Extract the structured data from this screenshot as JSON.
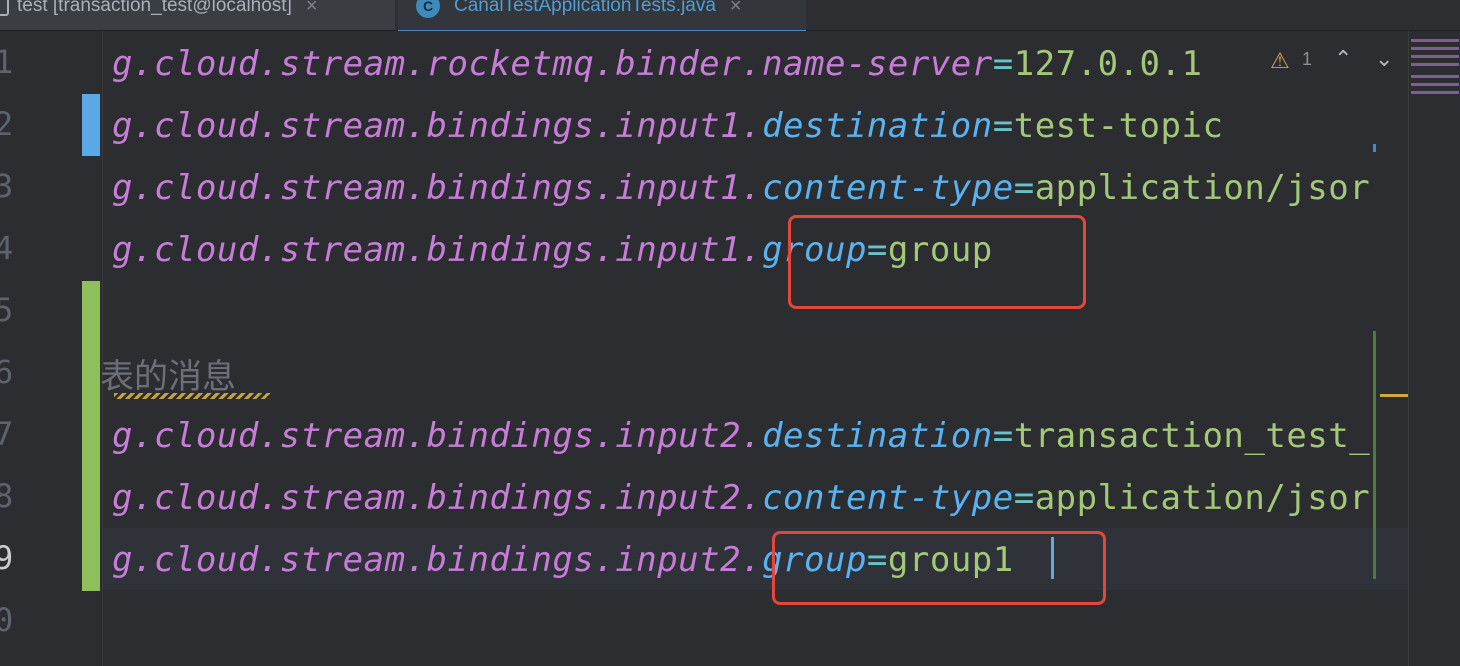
{
  "tabs": [
    {
      "label": "test [transaction_test@localhost]",
      "icon": "database-icon",
      "close": "×"
    },
    {
      "label": "CanalTestApplicationTests.java",
      "icon": "class-icon",
      "icon_letter": "C",
      "close": "×",
      "active": true
    }
  ],
  "inspections": {
    "warning_icon": "⚠",
    "warning_count": "1",
    "prev": "⌃",
    "next": "⌄"
  },
  "line_numbers": [
    "1",
    "2",
    "3",
    "4",
    "5",
    "6",
    "7",
    "8",
    "9",
    "0"
  ],
  "code": [
    {
      "key": "g.cloud.stream.rocketmq.binder.",
      "prop": "name-server",
      "eq": "=",
      "value": "127.0.0.1"
    },
    {
      "key": "g.cloud.stream.bindings.input1.",
      "prop": "destination",
      "eq": "=",
      "value": "test-topic"
    },
    {
      "key": "g.cloud.stream.bindings.input1.",
      "prop": "content-type",
      "eq": "=",
      "value": "application/jsor"
    },
    {
      "key": "g.cloud.stream.bindings.input1.",
      "prop": "group",
      "eq": "=",
      "value": "group"
    },
    {
      "key": "g.cloud.stream.bindings.input2.",
      "prop": "destination",
      "eq": "=",
      "value": "transaction_test_"
    },
    {
      "key": "g.cloud.stream.bindings.input2.",
      "prop": "content-type",
      "eq": "=",
      "value": "application/jsor"
    },
    {
      "key": "g.cloud.stream.bindings.input2.",
      "prop": "group",
      "eq": "=",
      "value": "group1"
    }
  ],
  "comment": "表的消息",
  "colors": {
    "key": "#c77dd8",
    "prop": "#5ab3f0",
    "value": "#a3c877",
    "highlight": "#e5463a",
    "added": "#8fbf5a",
    "modified": "#5aa9e6"
  }
}
